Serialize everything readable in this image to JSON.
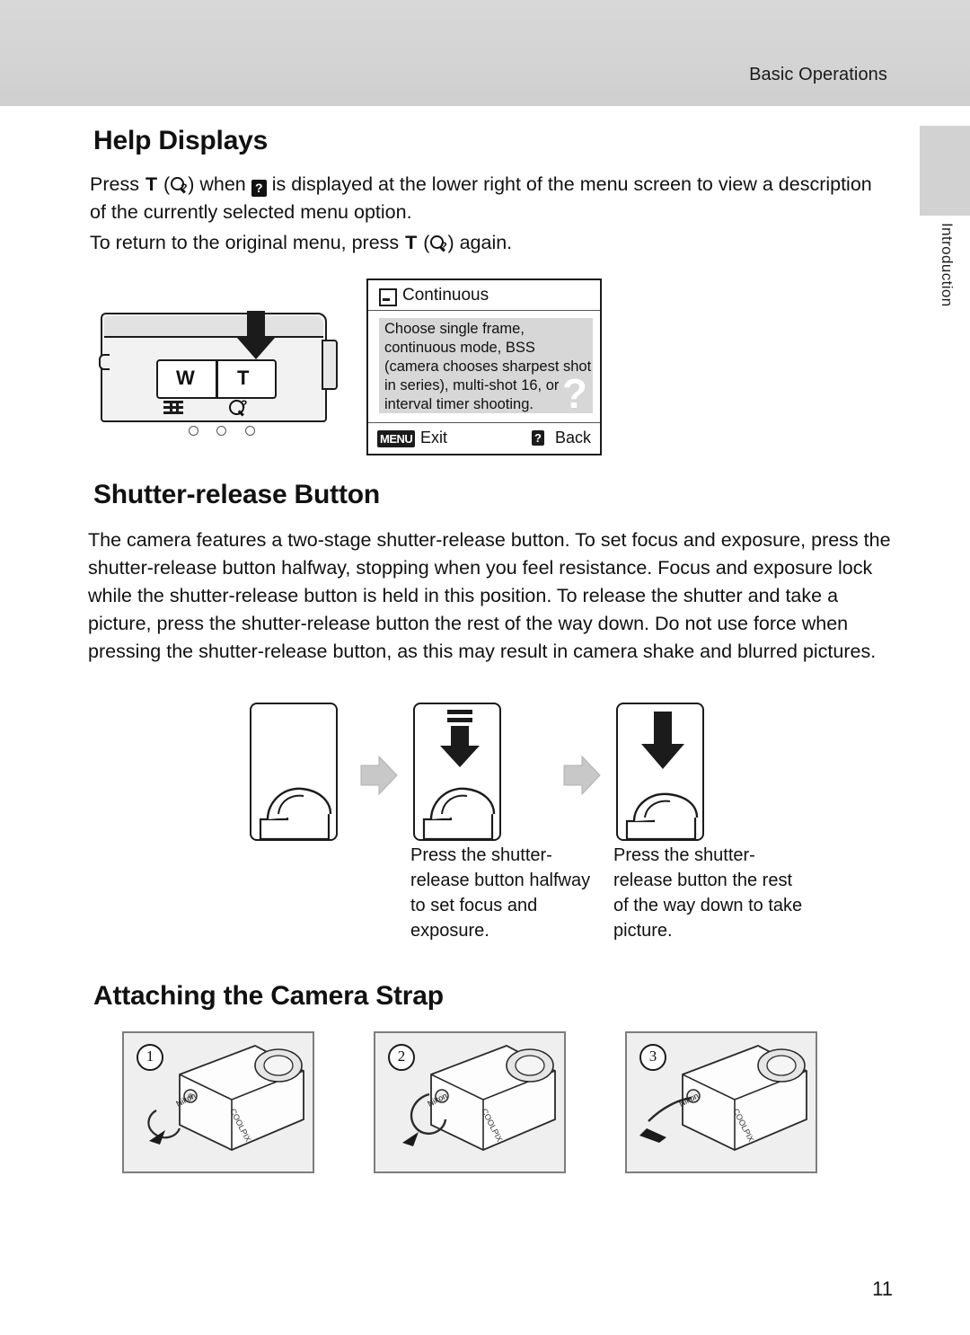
{
  "header": {
    "running_head": "Basic Operations",
    "side_tab_label": "Introduction"
  },
  "sections": {
    "help_displays": {
      "heading": "Help Displays",
      "para1_part1": "Press ",
      "para1_T": "T",
      "para1_part2": " (",
      "para1_part3": ") when ",
      "para1_part4": " is displayed at the lower right of the menu screen to view a description of the currently selected menu option.",
      "para2_part1": "To return to the original menu, press ",
      "para2_T": "T",
      "para2_part2": " (",
      "para2_part3": ") again."
    },
    "shutter": {
      "heading": "Shutter-release Button",
      "body": "The camera features a two-stage shutter-release button. To set focus and exposure, press the shutter-release button halfway, stopping when you feel resistance. Focus and exposure lock while the shutter-release button is held in this position. To release the shutter and take a picture, press the shutter-release button the rest of the way down. Do not use force when pressing the shutter-release button, as this may result in camera shake and blurred pictures.",
      "caption_halfway": "Press the shutter-release button halfway to set focus and exposure.",
      "caption_full": "Press the shutter-release button the rest of the way down to take picture."
    },
    "strap": {
      "heading": "Attaching the Camera Strap",
      "steps": [
        "1",
        "2",
        "3"
      ]
    }
  },
  "camera_illustration": {
    "zoom_wide_label": "W",
    "zoom_tele_label": "T"
  },
  "menu_screen": {
    "title": "Continuous",
    "body": "Choose single frame, continuous mode, BSS (camera chooses sharpest shot in series), multi-shot 16, or interval timer shooting.",
    "help_mark": "?",
    "footer_menu_icon": "MENU",
    "footer_exit": "Exit",
    "footer_back_icon": "?",
    "footer_back": "Back"
  },
  "strap_images": {
    "brand": "Nikon",
    "model": "COOLPIX"
  },
  "footer": {
    "page_number": "11"
  },
  "colors": {
    "header_band": "#d4d4d4",
    "side_tab": "#d2d2d2",
    "ink": "#111111",
    "screen_body": "#d7d7d7",
    "strap_bg": "#efefef"
  }
}
